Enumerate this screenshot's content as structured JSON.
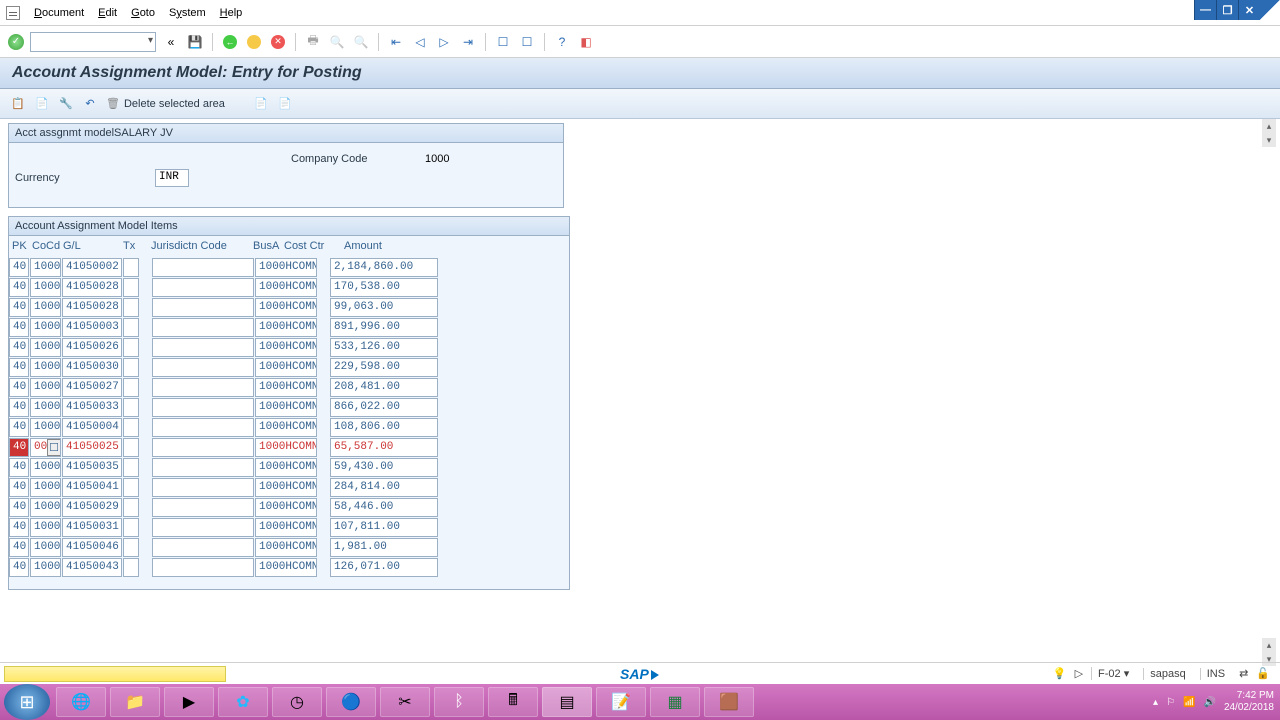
{
  "menu": {
    "items": [
      "Document",
      "Edit",
      "Goto",
      "System",
      "Help"
    ]
  },
  "page_title": "Account Assignment Model: Entry for Posting",
  "apptool": {
    "delete_label": "Delete selected area"
  },
  "header": {
    "model_label": "Acct assgnmt model",
    "model_value": "SALARY JV",
    "company_label": "Company Code",
    "company_value": "1000",
    "currency_label": "Currency",
    "currency_value": "INR"
  },
  "table": {
    "title": "Account Assignment Model Items",
    "cols": {
      "pk": "PK",
      "cocd": "CoCd",
      "gl": "G/L",
      "tx": "Tx",
      "jc": "Jurisdictn Code",
      "ba": "BusA",
      "cc": "Cost Ctr",
      "am": "Amount"
    },
    "active_index": 9,
    "rows": [
      {
        "pk": "40",
        "cocd": "1000",
        "gl": "41050002",
        "tx": "",
        "jc": "",
        "ba": "1000",
        "cc": "HCOMN",
        "am": "2,184,860.00"
      },
      {
        "pk": "40",
        "cocd": "1000",
        "gl": "41050028",
        "tx": "",
        "jc": "",
        "ba": "1000",
        "cc": "HCOMN",
        "am": "170,538.00"
      },
      {
        "pk": "40",
        "cocd": "1000",
        "gl": "41050028",
        "tx": "",
        "jc": "",
        "ba": "1000",
        "cc": "HCOMN",
        "am": "99,063.00"
      },
      {
        "pk": "40",
        "cocd": "1000",
        "gl": "41050003",
        "tx": "",
        "jc": "",
        "ba": "1000",
        "cc": "HCOMN",
        "am": "891,996.00"
      },
      {
        "pk": "40",
        "cocd": "1000",
        "gl": "41050026",
        "tx": "",
        "jc": "",
        "ba": "1000",
        "cc": "HCOMN",
        "am": "533,126.00"
      },
      {
        "pk": "40",
        "cocd": "1000",
        "gl": "41050030",
        "tx": "",
        "jc": "",
        "ba": "1000",
        "cc": "HCOMN",
        "am": "229,598.00"
      },
      {
        "pk": "40",
        "cocd": "1000",
        "gl": "41050027",
        "tx": "",
        "jc": "",
        "ba": "1000",
        "cc": "HCOMN",
        "am": "208,481.00"
      },
      {
        "pk": "40",
        "cocd": "1000",
        "gl": "41050033",
        "tx": "",
        "jc": "",
        "ba": "1000",
        "cc": "HCOMN",
        "am": "866,022.00"
      },
      {
        "pk": "40",
        "cocd": "1000",
        "gl": "41050004",
        "tx": "",
        "jc": "",
        "ba": "1000",
        "cc": "HCOMN",
        "am": "108,806.00"
      },
      {
        "pk": "40",
        "cocd": "  00",
        "gl": "41050025",
        "tx": "",
        "jc": "",
        "ba": "1000",
        "cc": "HCOMN",
        "am": "65,587.00"
      },
      {
        "pk": "40",
        "cocd": "1000",
        "gl": "41050035",
        "tx": "",
        "jc": "",
        "ba": "1000",
        "cc": "HCOMN",
        "am": "59,430.00"
      },
      {
        "pk": "40",
        "cocd": "1000",
        "gl": "41050041",
        "tx": "",
        "jc": "",
        "ba": "1000",
        "cc": "HCOMN",
        "am": "284,814.00"
      },
      {
        "pk": "40",
        "cocd": "1000",
        "gl": "41050029",
        "tx": "",
        "jc": "",
        "ba": "1000",
        "cc": "HCOMN",
        "am": "58,446.00"
      },
      {
        "pk": "40",
        "cocd": "1000",
        "gl": "41050031",
        "tx": "",
        "jc": "",
        "ba": "1000",
        "cc": "HCOMN",
        "am": "107,811.00"
      },
      {
        "pk": "40",
        "cocd": "1000",
        "gl": "41050046",
        "tx": "",
        "jc": "",
        "ba": "1000",
        "cc": "HCOMN",
        "am": "1,981.00"
      },
      {
        "pk": "40",
        "cocd": "1000",
        "gl": "41050043",
        "tx": "",
        "jc": "",
        "ba": "1000",
        "cc": "HCOMN",
        "am": "126,071.00"
      }
    ]
  },
  "status": {
    "sap": "SAP",
    "tcode": "F-02",
    "user": "sapasq",
    "mode": "INS"
  },
  "taskbar": {
    "time": "7:42 PM",
    "date": "24/02/2018"
  }
}
